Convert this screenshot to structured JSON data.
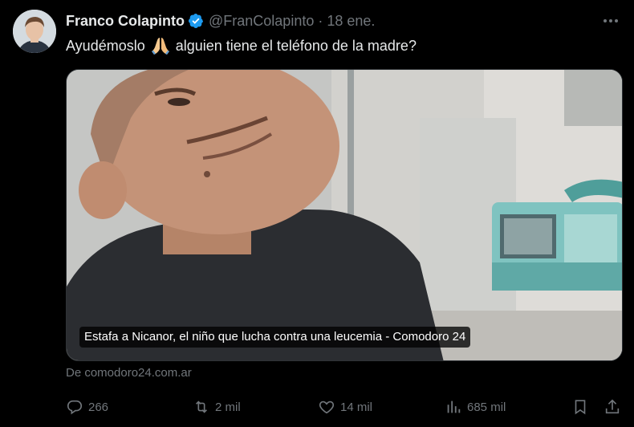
{
  "tweet": {
    "author": {
      "display_name": "Franco Colapinto",
      "handle": "@FranColapinto",
      "verified": true
    },
    "separator": "·",
    "time": "18 ene.",
    "text_before_emoji": "Ayudémoslo",
    "emoji": "folded-hands",
    "text_after_emoji": "alguien tiene el teléfono de la madre?",
    "link_card": {
      "title": "Estafa a Nicanor, el niño que lucha contra una leucemia - Comodoro 24",
      "source": "De comodoro24.com.ar"
    },
    "actions": {
      "replies": "266",
      "reposts": "2 mil",
      "likes": "14 mil",
      "views": "685 mil"
    }
  },
  "colors": {
    "background": "#000000",
    "text": "#e7e9ea",
    "muted": "#71767b",
    "verified": "#1d9bf0"
  }
}
